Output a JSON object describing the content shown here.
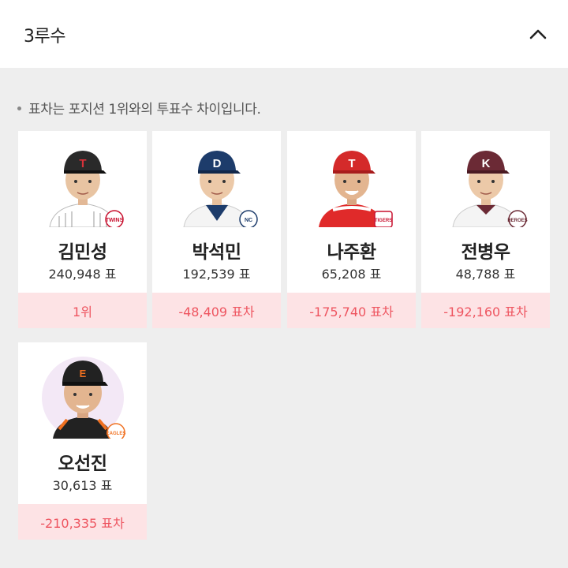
{
  "header": {
    "title": "3루수",
    "toggle_icon": "chevron-up-icon"
  },
  "notice": "표차는 포지션 1위와의 투표수 차이입니다.",
  "colors": {
    "diff_bg": "#fde3e5",
    "diff_text": "#ee5560"
  },
  "players": [
    {
      "name": "김민성",
      "votes": "240,948 표",
      "diff": "1위",
      "team_logo": "twins-logo",
      "cap_color": "#2a2a2a",
      "cap_letter": "T",
      "jersey": "#ffffff"
    },
    {
      "name": "박석민",
      "votes": "192,539 표",
      "diff": "-48,409 표차",
      "team_logo": "dinos-logo",
      "cap_color": "#1d3c6b",
      "cap_letter": "D",
      "jersey": "#f4f4f4"
    },
    {
      "name": "나주환",
      "votes": "65,208 표",
      "diff": "-175,740 표차",
      "team_logo": "tigers-logo",
      "cap_color": "#d42a2a",
      "cap_letter": "T",
      "jersey": "#e02a2a"
    },
    {
      "name": "전병우",
      "votes": "48,788 표",
      "diff": "-192,160 표차",
      "team_logo": "heroes-logo",
      "cap_color": "#6b2a35",
      "cap_letter": "K",
      "jersey": "#f4f4f4"
    },
    {
      "name": "오선진",
      "votes": "30,613 표",
      "diff": "-210,335 표차",
      "team_logo": "eagles-logo",
      "cap_color": "#222222",
      "cap_letter": "E",
      "jersey": "#222222"
    }
  ]
}
